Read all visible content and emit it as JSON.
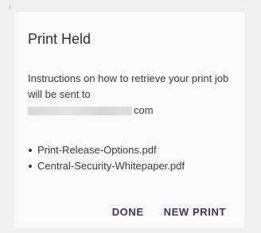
{
  "dialog": {
    "title": "Print Held",
    "instructions": "Instructions on how to retrieve your print job will be sent to",
    "email_suffix": "com",
    "files": [
      "Print-Release-Options.pdf",
      "Central-Security-Whitepaper.pdf"
    ],
    "done_label": "DONE",
    "new_print_label": "NEW PRINT"
  },
  "colors": {
    "accent": "#4a2a6e",
    "text": "#3c3c3c",
    "background": "#fafafa"
  }
}
